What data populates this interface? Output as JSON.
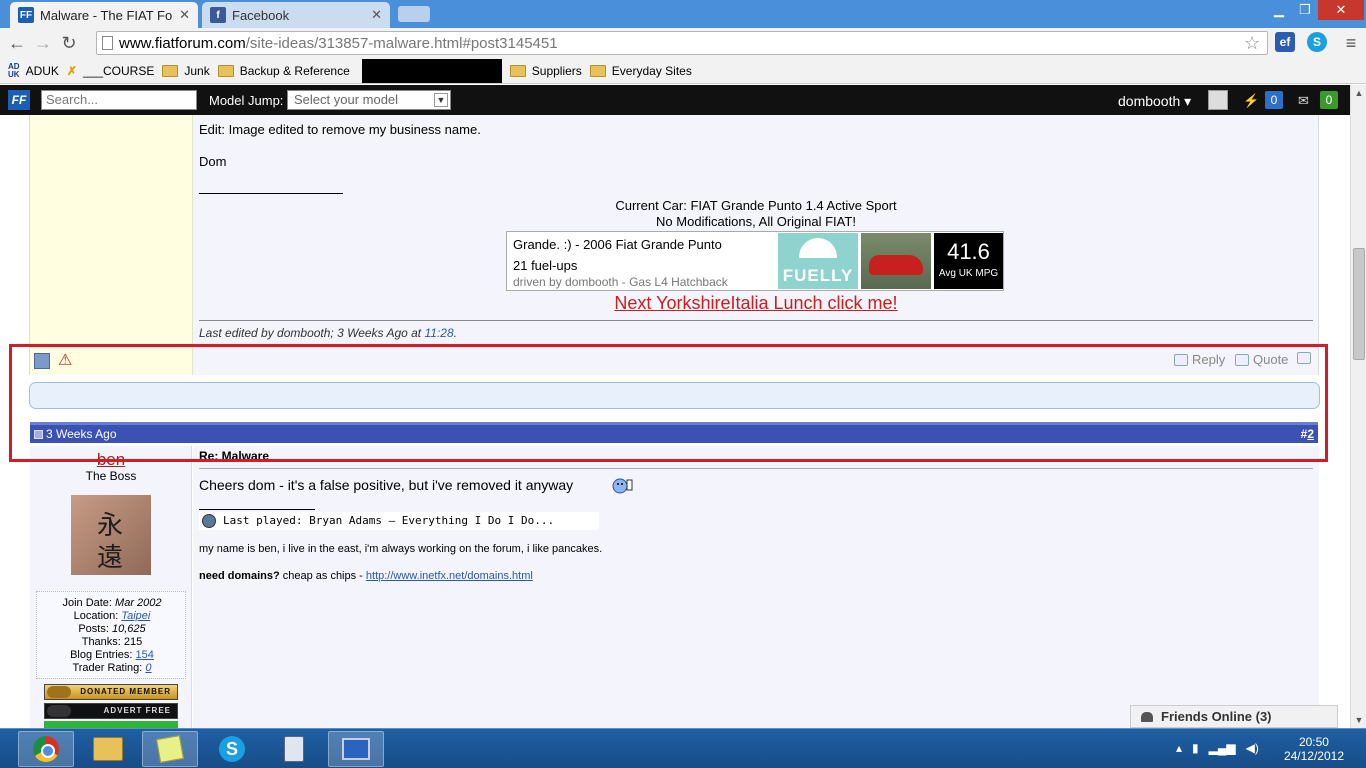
{
  "browser": {
    "tabs": [
      {
        "label": "Malware - The FIAT Forum",
        "favicon": "FF",
        "active": true
      },
      {
        "label": "Facebook",
        "favicon": "f",
        "active": false
      }
    ],
    "url_host": "www.fiatforum.com",
    "url_path": "/site-ideas/313857-malware.html#post3145451",
    "bookmarks": [
      "ADUK",
      "___COURSE",
      "Junk",
      "Backup & Reference",
      "Suppliers",
      "Everyday Sites"
    ],
    "extensions": [
      "ef",
      "S"
    ]
  },
  "forum_bar": {
    "search_placeholder": "Search...",
    "model_jump_label": "Model Jump:",
    "model_select_value": "Select your model",
    "username": "dombooth",
    "notifications_count": "0",
    "messages_count": "0"
  },
  "post1": {
    "edit_note": "Edit: Image edited to remove my business name.",
    "sign_off": "Dom",
    "sig_car": "Current Car: FIAT Grande Punto 1.4 Active Sport",
    "sig_mods": "No Modifications, All Original FIAT!",
    "fuelly": {
      "title": "Grande. :) - 2006 Fiat Grande Punto",
      "fuelups": "21 fuel-ups",
      "driven_by": "driven by dombooth - Gas L4 Hatchback",
      "logo": "FUELLY",
      "mpg": "41.6",
      "mpg_unit": "Avg UK MPG"
    },
    "lunch_link": "Next YorkshireItalia Lunch click me!",
    "last_edited_prefix": "Last edited by dombooth; 3 Weeks Ago at ",
    "last_edited_time": "11:28",
    "reply_label": "Reply",
    "quote_label": "Quote"
  },
  "post2": {
    "date": "3 Weeks Ago",
    "number_prefix": "#",
    "number": "2",
    "username": "ben",
    "user_title": "The Boss",
    "avatar_chars": [
      "永",
      "遠"
    ],
    "join_date_label": "Join Date:",
    "join_date": "Mar 2002",
    "location_label": "Location:",
    "location": "Taipei",
    "posts_label": "Posts:",
    "posts": "10,625",
    "thanks_label": "Thanks:",
    "thanks": "215",
    "blog_label": "Blog Entries:",
    "blog": "154",
    "trader_label": "Trader Rating:",
    "trader": "0",
    "badge1": "DONATED MEMBER",
    "badge2": "ADVERT FREE",
    "title": "Re: Malware",
    "message": "Cheers dom - it's a false positive, but i've removed it anyway",
    "last_played": "Last played:  Bryan Adams – Everything I Do I Do...",
    "sig_line1": "my name is ben, i live in the east, i'm always working on the forum, i like pancakes.",
    "sig_domains_bold": "need domains?",
    "sig_domains_text": " cheap as chips - ",
    "sig_domains_link": "http://www.inetfx.net/domains.html"
  },
  "friends_online": "Friends Online (3)",
  "taskbar": {
    "time": "20:50",
    "date": "24/12/2012"
  }
}
